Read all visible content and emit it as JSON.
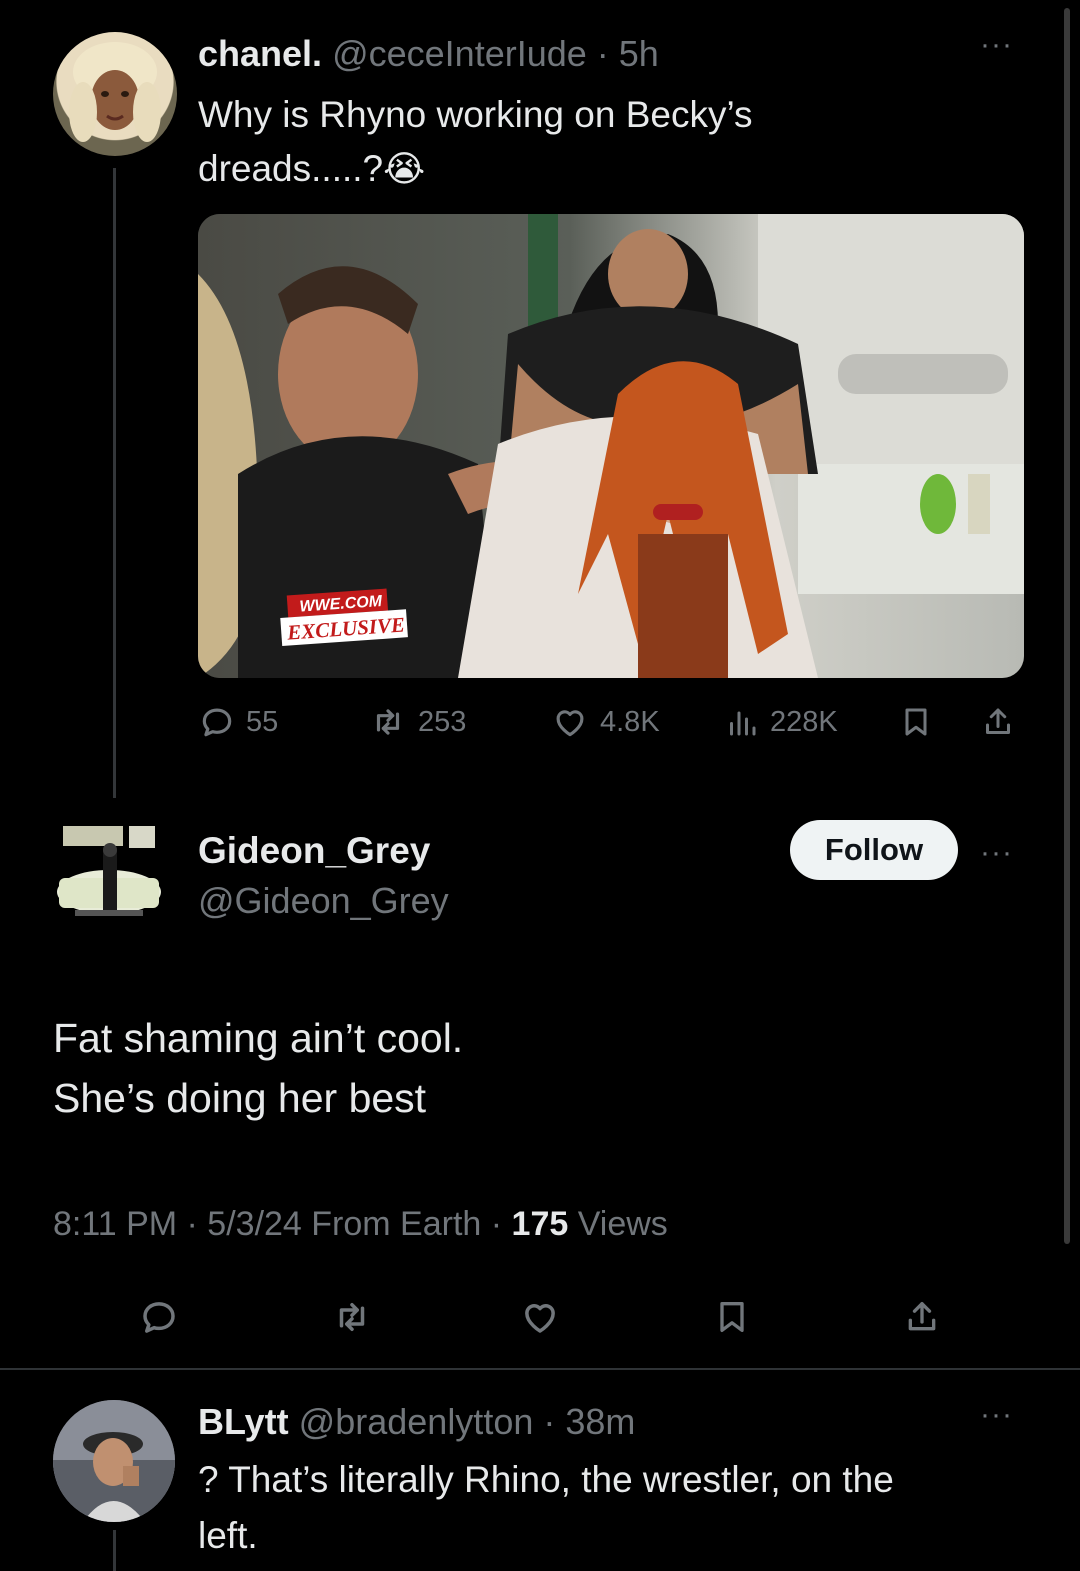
{
  "tweet1": {
    "display_name": "chanel.",
    "handle": "@ceceInterIude",
    "time": "· 5h",
    "text_line1": "Why is Rhyno working on Becky’s",
    "text_line2": "dreads.....?",
    "emoji": "😭",
    "media_badge_line1": "WWE.COM",
    "media_badge_line2": "EXCLUSIVE",
    "stats": {
      "replies": "55",
      "reposts": "253",
      "likes": "4.8K",
      "views": "228K"
    }
  },
  "tweet2": {
    "display_name": "Gideon_Grey",
    "handle": "@Gideon_Grey",
    "follow_label": "Follow",
    "text_line1": "Fat shaming ain’t cool.",
    "text_line2": "She’s doing her best",
    "meta_time": "8:11 PM · 5/3/24 From Earth · ",
    "meta_views_count": "175",
    "meta_views_label": " Views"
  },
  "tweet3": {
    "display_name": "BLytt",
    "handle": "@bradenlytton",
    "time": "· 38m",
    "text_line1": "? That’s literally Rhino, the wrestler, on the",
    "text_line2": "left."
  },
  "icons": {
    "reply": "speech-bubble",
    "repost": "repeat-arrows",
    "like": "heart",
    "views": "bar-chart",
    "bookmark": "bookmark",
    "share": "upload-arrow",
    "more": "ellipsis"
  },
  "colors": {
    "background": "#000000",
    "text": "#e7e9ea",
    "muted": "#71767b",
    "follow_bg": "#eff3f4"
  }
}
